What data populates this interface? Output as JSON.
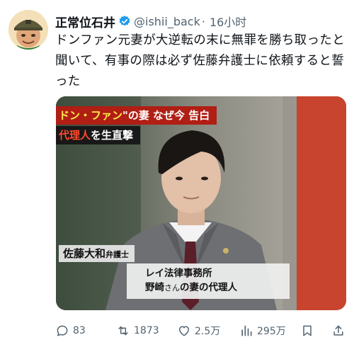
{
  "post": {
    "author_name": "正常位石井",
    "handle": "@ishii_back",
    "separator": "·",
    "time": "16小时",
    "text": "ドンファン元妻が大逆転の末に無罪を勝ち取ったと聞いて、有事の際は必ず佐藤弁護士に依頼すると誓った",
    "colors": {
      "text": "#0f1419",
      "muted": "#536471",
      "verified": "#1d9bf0"
    }
  },
  "media": {
    "caption_line1_lead": "ドン・ファン",
    "caption_line1_rest": "\"の妻 なぜ今 告白",
    "caption_line2_lead": "代理人",
    "caption_line2_rest": "を生直撃",
    "name_tag": "佐藤大和",
    "name_tag_title": "弁護士",
    "firm": "レイ法律事務所",
    "role_name": "野崎",
    "role_honorific": "さん",
    "role_rest": "の妻の代理人"
  },
  "actions": {
    "replies": "83",
    "reposts": "1873",
    "likes": "2.5万",
    "views": "295万"
  }
}
